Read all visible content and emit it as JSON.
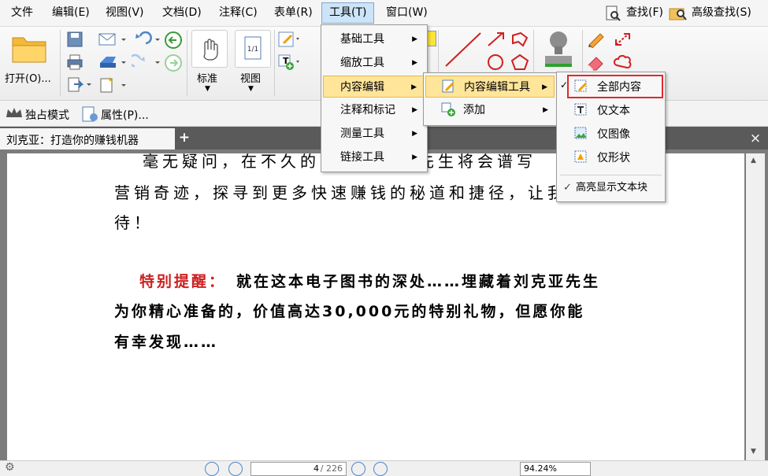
{
  "menubar": {
    "items": [
      "文件",
      "编辑(E)",
      "视图(V)",
      "文档(D)",
      "注释(C)",
      "表单(R)",
      "工具(T)",
      "窗口(W)"
    ],
    "search_label": "查找(F)",
    "advanced_search_label": "高级查找(S)"
  },
  "ribbon": {
    "open_label": "打开(O)...",
    "hand_label": "标准",
    "view_label": "视图",
    "page_icon_text": "1/1",
    "insert_icon_text": "T"
  },
  "modebar": {
    "exclusive_label": "独占模式",
    "properties_label": "属性(P)..."
  },
  "tab": {
    "title": "刘克亚：打造你的赚钱机器",
    "add_label": "+",
    "close_label": "×"
  },
  "document": {
    "line1": "毫无疑问，在不久的　　　　亚先生将会谱写",
    "line2": "营销奇迹，探寻到更多快速赚钱的秘道和捷径，让我",
    "line3": "待！",
    "highlight_label": "特别提醒：",
    "bold_line1": "就在这本电子图书的深处……埋藏着刘克亚先生",
    "bold_line2": "为你精心准备的，价值高达30,000元的特别礼物，但愿你能",
    "bold_line3": "有幸发现……"
  },
  "tools_menu": {
    "items": [
      "基础工具",
      "缩放工具",
      "内容编辑",
      "注释和标记",
      "测量工具",
      "链接工具"
    ]
  },
  "content_edit_menu": {
    "items": [
      "内容编辑工具",
      "添加"
    ]
  },
  "content_tools_menu": {
    "items": [
      "全部内容",
      "仅文本",
      "仅图像",
      "仅形状"
    ],
    "highlight_toggle": "高亮显示文本块",
    "check_mark": "✓"
  },
  "statusbar": {
    "page_value": "4",
    "page_total": "/ 226",
    "zoom_value": "94.24%"
  },
  "colors": {
    "accent_red": "#cc1f1f",
    "menu_highlight": "#ffe59a",
    "selection_box": "#e0282a"
  }
}
